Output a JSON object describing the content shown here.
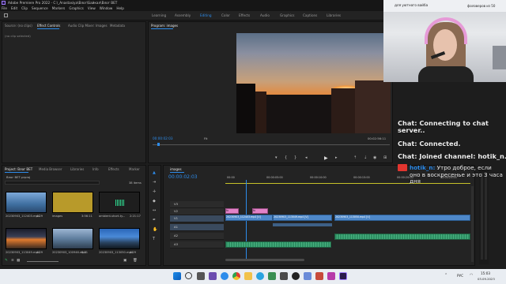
{
  "window": {
    "title": "Adobe Premiere Pro 2022 - C:\\_Anastasiya\\Влог\\Байкал\\Влог ВЕТ"
  },
  "menu": [
    "File",
    "Edit",
    "Clip",
    "Sequence",
    "Markers",
    "Graphics",
    "View",
    "Window",
    "Help"
  ],
  "workspaces": {
    "items": [
      "Learning",
      "Assembly",
      "Editing",
      "Color",
      "Effects",
      "Audio",
      "Graphics",
      "Captions",
      "Libraries"
    ],
    "active": "Editing"
  },
  "source_panel": {
    "tabs": [
      "Source: (no clips)",
      "Effect Controls",
      "Audio Clip Mixer: Images",
      "Metadata"
    ],
    "empty_text": "(no clip selected)"
  },
  "program_monitor": {
    "title": "Program: images",
    "timecode_left": "00:00:02:03",
    "fit": "Fit",
    "timecode_right": "00:02:56:11"
  },
  "project_panel": {
    "tabs": [
      "Project: Влог ВЕТ",
      "Media Browser",
      "Libraries",
      "Info",
      "Effects",
      "Marker"
    ],
    "project_file": "Влог ВЕТ.prproj",
    "item_count": "38 items",
    "items": [
      {
        "name": "20230903_112403.mp4",
        "duration": "4:29"
      },
      {
        "name": "images",
        "duration": "3:56:11"
      },
      {
        "name": "ambient-short-ty...",
        "duration": "2:21:17"
      },
      {
        "name": "20230903_113049.mp4",
        "duration": "4:29"
      },
      {
        "name": "20230903_100946.mp4",
        "duration": "8:21"
      },
      {
        "name": "20230903_113050.mp4",
        "duration": "4:29"
      }
    ]
  },
  "timeline": {
    "tab": "images",
    "timecode": "00:00:02:03",
    "ruler": [
      "00:00",
      "00:00:05:00",
      "00:00:10:00",
      "00:00:15:00",
      "00:00:20:00",
      "00:00:25:00"
    ],
    "tracks": [
      "V3",
      "V2",
      "V1",
      "A1",
      "A2",
      "A3"
    ],
    "clips": {
      "pink1": "fx",
      "pink2": "fx",
      "v1a": "20230903_112403.mp4 [V]",
      "v1b": "20230903_113049.mp4 [V]",
      "v1c": "20230903_113050.mp4 [V]"
    }
  },
  "webcam": {
    "banner": "для уютного вайба",
    "counter": "фоловеров из 50"
  },
  "chat": {
    "lines": [
      {
        "speaker": "Chat:",
        "text": "Connecting to chat server.."
      },
      {
        "speaker": "Chat:",
        "text": "Connected."
      },
      {
        "speaker": "Chat:",
        "text": "Joined channel: hotik_n."
      }
    ],
    "message": {
      "user": "hotik_n:",
      "text": "Утро доброе, если оно в воскресенье и это 3 часа дня"
    }
  },
  "taskbar": {
    "lang": "РУС",
    "time": "15:03",
    "date": "03.09.2023"
  },
  "colors": {
    "accent": "#2d8ceb",
    "video_clip": "#4e88c9",
    "audio_clip": "#2f8f64",
    "fx_clip": "#e283c7",
    "chat_user": "#2d8ceb"
  }
}
